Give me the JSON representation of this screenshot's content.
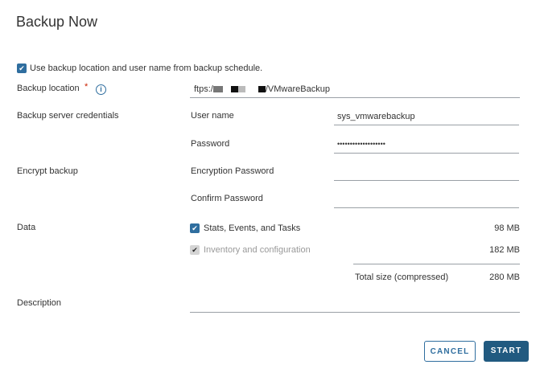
{
  "dialog": {
    "title": "Backup Now"
  },
  "use_schedule": {
    "label": "Use backup location and user name from backup schedule.",
    "checked": true
  },
  "location": {
    "label": "Backup location",
    "required_mark": "*",
    "value_prefix": "ftps:/",
    "value_suffix": "/VMwareBackup",
    "icon": "info-icon"
  },
  "credentials": {
    "label": "Backup server credentials",
    "username_label": "User name",
    "username_value": "sys_vmwarebackup",
    "password_label": "Password",
    "password_value": "•••••••••••••••••••"
  },
  "encrypt": {
    "label": "Encrypt backup",
    "enc_password_label": "Encryption Password",
    "confirm_label": "Confirm Password"
  },
  "data": {
    "label": "Data",
    "items": [
      {
        "label": "Stats, Events, and Tasks",
        "size": "98 MB",
        "checked": true,
        "disabled": false
      },
      {
        "label": "Inventory and configuration",
        "size": "182 MB",
        "checked": true,
        "disabled": true
      }
    ],
    "total_label": "Total size (compressed)",
    "total_size": "280 MB"
  },
  "description": {
    "label": "Description"
  },
  "buttons": {
    "cancel": "CANCEL",
    "start": "START"
  },
  "colors": {
    "accent": "#2f6e9f",
    "primary_button": "#215a80",
    "required": "#c92100"
  }
}
